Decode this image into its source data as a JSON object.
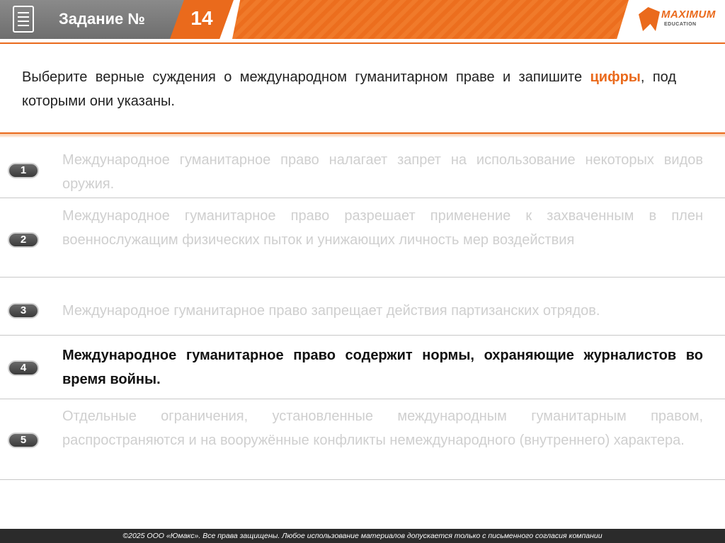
{
  "header": {
    "title": "Задание №",
    "number": "14",
    "logo": {
      "name": "MAXIMUM",
      "sub": "EDUCATION"
    }
  },
  "question": {
    "part1": "Выберите верные суждения о международном гуманитарном праве и запишите ",
    "highlight": "цифры",
    "part2": ", под которыми они указаны."
  },
  "options": [
    {
      "num": "1",
      "text": "Международное гуманитарное право налагает запрет на использование некоторых видов оружия.",
      "correct": false
    },
    {
      "num": "2",
      "text": "Международное гуманитарное право разрешает применение к захваченным в плен военнослужащим физических пыток и унижающих личность мер воздействия",
      "correct": false
    },
    {
      "num": "3",
      "text": "Международное гуманитарное право запрещает действия партизанских отрядов.",
      "correct": false
    },
    {
      "num": "4",
      "text": "Международное гуманитарное право содержит нормы, охраняющие журналистов во время войны.",
      "correct": true
    },
    {
      "num": "5",
      "text": "Отдельные ограничения, установленные международным гуманитарным правом, распространяются и на вооружённые конфликты немеждународного (внутреннего) характера.",
      "correct": false
    }
  ],
  "footer": {
    "copyright": "©2025 ООО «Юмакс». Все права защищены. Любое использование материалов допускается только с письменного согласия компании"
  },
  "colors": {
    "accent": "#ea6a1c",
    "header_gray": "#7a7a7a",
    "faded_text": "#cfcfcf",
    "correct_text": "#111111"
  }
}
